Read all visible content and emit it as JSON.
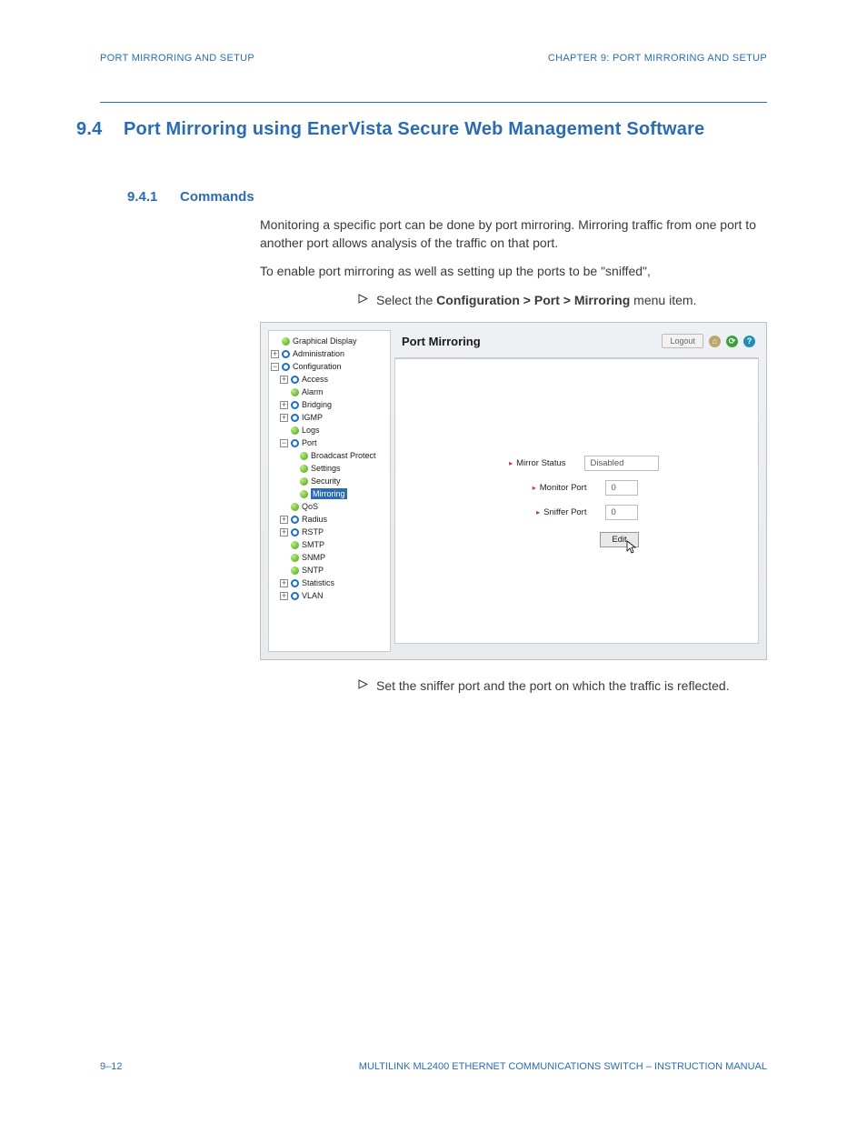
{
  "header": {
    "left": "PORT MIRRORING AND SETUP",
    "right": "CHAPTER 9: PORT MIRRORING AND SETUP"
  },
  "section": {
    "number": "9.4",
    "title": "Port Mirroring using EnerVista Secure Web Management Software"
  },
  "subsection": {
    "number": "9.4.1",
    "title": "Commands"
  },
  "paragraphs": {
    "p1": "Monitoring a specific port can be done by port mirroring. Mirroring traffic from one port to another port allows analysis of the traffic on that port.",
    "p2": "To enable port mirroring as well as setting up the ports to be \"sniffed\","
  },
  "steps": {
    "s1_pre": "Select the ",
    "s1_bold": "Configuration > Port > Mirroring",
    "s1_post": " menu item.",
    "s2": "Set the sniffer port and the port on which the traffic is reflected."
  },
  "screenshot": {
    "content_title": "Port Mirroring",
    "logout": "Logout",
    "tree": [
      {
        "indent": 0,
        "box": null,
        "icon": "green",
        "label": "Graphical Display"
      },
      {
        "indent": 0,
        "box": "plus",
        "icon": "blue",
        "label": "Administration"
      },
      {
        "indent": 0,
        "box": "minus",
        "icon": "blue",
        "label": "Configuration"
      },
      {
        "indent": 1,
        "box": "plus",
        "icon": "blue",
        "label": "Access"
      },
      {
        "indent": 1,
        "box": null,
        "icon": "green",
        "label": "Alarm"
      },
      {
        "indent": 1,
        "box": "plus",
        "icon": "blue",
        "label": "Bridging"
      },
      {
        "indent": 1,
        "box": "plus",
        "icon": "blue",
        "label": "IGMP"
      },
      {
        "indent": 1,
        "box": null,
        "icon": "green",
        "label": "Logs"
      },
      {
        "indent": 1,
        "box": "minus",
        "icon": "blue",
        "label": "Port"
      },
      {
        "indent": 2,
        "box": null,
        "icon": "green",
        "label": "Broadcast Protect"
      },
      {
        "indent": 2,
        "box": null,
        "icon": "green",
        "label": "Settings"
      },
      {
        "indent": 2,
        "box": null,
        "icon": "green",
        "label": "Security"
      },
      {
        "indent": 2,
        "box": null,
        "icon": "green",
        "label": "Mirroring",
        "selected": true
      },
      {
        "indent": 1,
        "box": null,
        "icon": "green",
        "label": "QoS"
      },
      {
        "indent": 1,
        "box": "plus",
        "icon": "blue",
        "label": "Radius"
      },
      {
        "indent": 1,
        "box": "plus",
        "icon": "blue",
        "label": "RSTP"
      },
      {
        "indent": 1,
        "box": null,
        "icon": "green",
        "label": "SMTP"
      },
      {
        "indent": 1,
        "box": null,
        "icon": "green",
        "label": "SNMP"
      },
      {
        "indent": 1,
        "box": null,
        "icon": "green",
        "label": "SNTP"
      },
      {
        "indent": 1,
        "box": "plus",
        "icon": "blue",
        "label": "Statistics"
      },
      {
        "indent": 1,
        "box": "plus",
        "icon": "blue",
        "label": "VLAN"
      }
    ],
    "form": {
      "mirror_status": {
        "label": "Mirror Status",
        "value": "Disabled"
      },
      "monitor_port": {
        "label": "Monitor Port",
        "value": "0"
      },
      "sniffer_port": {
        "label": "Sniffer Port",
        "value": "0"
      },
      "button": "Edit"
    }
  },
  "footer": {
    "page": "9–12",
    "doc": "MULTILINK ML2400 ETHERNET COMMUNICATIONS SWITCH – INSTRUCTION MANUAL"
  }
}
